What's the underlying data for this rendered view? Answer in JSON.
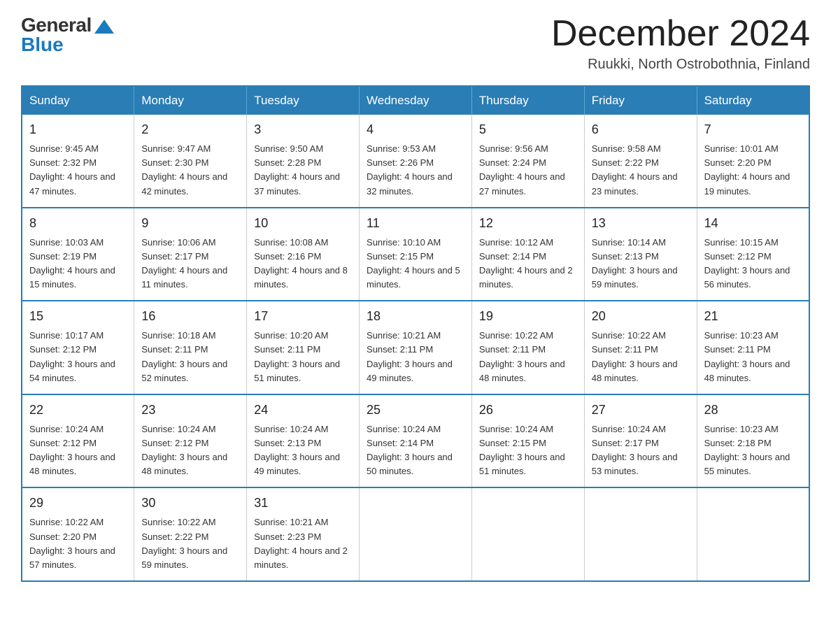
{
  "logo": {
    "general_text": "General",
    "blue_text": "Blue"
  },
  "title": {
    "month_year": "December 2024",
    "location": "Ruukki, North Ostrobothnia, Finland"
  },
  "headers": [
    "Sunday",
    "Monday",
    "Tuesday",
    "Wednesday",
    "Thursday",
    "Friday",
    "Saturday"
  ],
  "weeks": [
    [
      {
        "day": "1",
        "sunrise": "9:45 AM",
        "sunset": "2:32 PM",
        "daylight": "4 hours and 47 minutes."
      },
      {
        "day": "2",
        "sunrise": "9:47 AM",
        "sunset": "2:30 PM",
        "daylight": "4 hours and 42 minutes."
      },
      {
        "day": "3",
        "sunrise": "9:50 AM",
        "sunset": "2:28 PM",
        "daylight": "4 hours and 37 minutes."
      },
      {
        "day": "4",
        "sunrise": "9:53 AM",
        "sunset": "2:26 PM",
        "daylight": "4 hours and 32 minutes."
      },
      {
        "day": "5",
        "sunrise": "9:56 AM",
        "sunset": "2:24 PM",
        "daylight": "4 hours and 27 minutes."
      },
      {
        "day": "6",
        "sunrise": "9:58 AM",
        "sunset": "2:22 PM",
        "daylight": "4 hours and 23 minutes."
      },
      {
        "day": "7",
        "sunrise": "10:01 AM",
        "sunset": "2:20 PM",
        "daylight": "4 hours and 19 minutes."
      }
    ],
    [
      {
        "day": "8",
        "sunrise": "10:03 AM",
        "sunset": "2:19 PM",
        "daylight": "4 hours and 15 minutes."
      },
      {
        "day": "9",
        "sunrise": "10:06 AM",
        "sunset": "2:17 PM",
        "daylight": "4 hours and 11 minutes."
      },
      {
        "day": "10",
        "sunrise": "10:08 AM",
        "sunset": "2:16 PM",
        "daylight": "4 hours and 8 minutes."
      },
      {
        "day": "11",
        "sunrise": "10:10 AM",
        "sunset": "2:15 PM",
        "daylight": "4 hours and 5 minutes."
      },
      {
        "day": "12",
        "sunrise": "10:12 AM",
        "sunset": "2:14 PM",
        "daylight": "4 hours and 2 minutes."
      },
      {
        "day": "13",
        "sunrise": "10:14 AM",
        "sunset": "2:13 PM",
        "daylight": "3 hours and 59 minutes."
      },
      {
        "day": "14",
        "sunrise": "10:15 AM",
        "sunset": "2:12 PM",
        "daylight": "3 hours and 56 minutes."
      }
    ],
    [
      {
        "day": "15",
        "sunrise": "10:17 AM",
        "sunset": "2:12 PM",
        "daylight": "3 hours and 54 minutes."
      },
      {
        "day": "16",
        "sunrise": "10:18 AM",
        "sunset": "2:11 PM",
        "daylight": "3 hours and 52 minutes."
      },
      {
        "day": "17",
        "sunrise": "10:20 AM",
        "sunset": "2:11 PM",
        "daylight": "3 hours and 51 minutes."
      },
      {
        "day": "18",
        "sunrise": "10:21 AM",
        "sunset": "2:11 PM",
        "daylight": "3 hours and 49 minutes."
      },
      {
        "day": "19",
        "sunrise": "10:22 AM",
        "sunset": "2:11 PM",
        "daylight": "3 hours and 48 minutes."
      },
      {
        "day": "20",
        "sunrise": "10:22 AM",
        "sunset": "2:11 PM",
        "daylight": "3 hours and 48 minutes."
      },
      {
        "day": "21",
        "sunrise": "10:23 AM",
        "sunset": "2:11 PM",
        "daylight": "3 hours and 48 minutes."
      }
    ],
    [
      {
        "day": "22",
        "sunrise": "10:24 AM",
        "sunset": "2:12 PM",
        "daylight": "3 hours and 48 minutes."
      },
      {
        "day": "23",
        "sunrise": "10:24 AM",
        "sunset": "2:12 PM",
        "daylight": "3 hours and 48 minutes."
      },
      {
        "day": "24",
        "sunrise": "10:24 AM",
        "sunset": "2:13 PM",
        "daylight": "3 hours and 49 minutes."
      },
      {
        "day": "25",
        "sunrise": "10:24 AM",
        "sunset": "2:14 PM",
        "daylight": "3 hours and 50 minutes."
      },
      {
        "day": "26",
        "sunrise": "10:24 AM",
        "sunset": "2:15 PM",
        "daylight": "3 hours and 51 minutes."
      },
      {
        "day": "27",
        "sunrise": "10:24 AM",
        "sunset": "2:17 PM",
        "daylight": "3 hours and 53 minutes."
      },
      {
        "day": "28",
        "sunrise": "10:23 AM",
        "sunset": "2:18 PM",
        "daylight": "3 hours and 55 minutes."
      }
    ],
    [
      {
        "day": "29",
        "sunrise": "10:22 AM",
        "sunset": "2:20 PM",
        "daylight": "3 hours and 57 minutes."
      },
      {
        "day": "30",
        "sunrise": "10:22 AM",
        "sunset": "2:22 PM",
        "daylight": "3 hours and 59 minutes."
      },
      {
        "day": "31",
        "sunrise": "10:21 AM",
        "sunset": "2:23 PM",
        "daylight": "4 hours and 2 minutes."
      },
      null,
      null,
      null,
      null
    ]
  ]
}
